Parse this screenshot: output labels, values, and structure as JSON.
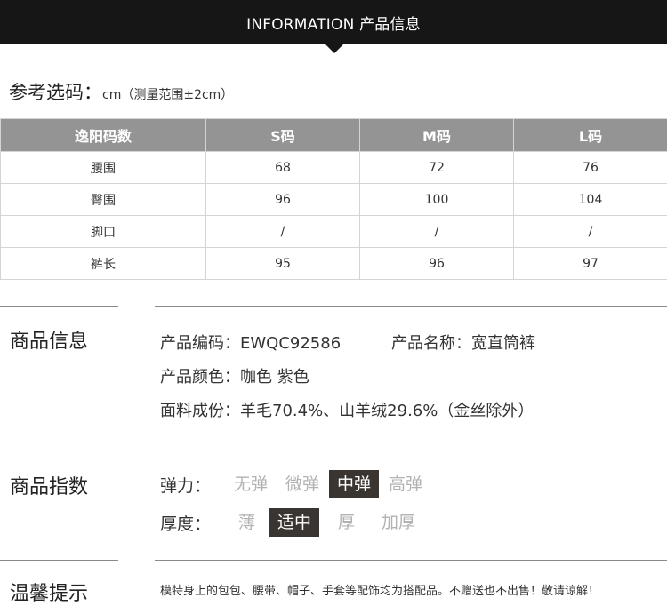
{
  "header": {
    "title": "INFORMATION 产品信息"
  },
  "size_reference": {
    "title": "参考选码：",
    "unit": "cm（测量范围±2cm）",
    "columns": [
      "逸阳码数",
      "S码",
      "M码",
      "L码"
    ],
    "rows": [
      [
        "腰围",
        "68",
        "72",
        "76"
      ],
      [
        "臀围",
        "96",
        "100",
        "104"
      ],
      [
        "脚口",
        "/",
        "/",
        "/"
      ],
      [
        "裤长",
        "95",
        "96",
        "97"
      ]
    ]
  },
  "product_info": {
    "title": "商品信息",
    "code": "产品编码：EWQC92586",
    "name": "产品名称：宽直筒裤",
    "color": "产品颜色：咖色  紫色",
    "material": "面料成份：羊毛70.4%、山羊绒29.6%（金丝除外）"
  },
  "product_index": {
    "title": "商品指数",
    "elasticity": {
      "label": "弹力：",
      "options": [
        "无弹",
        "微弹",
        "中弹",
        "高弹"
      ],
      "selected": "中弹"
    },
    "thickness": {
      "label": "厚度：",
      "options": [
        "薄",
        "适中",
        "厚",
        "加厚"
      ],
      "selected": "适中"
    }
  },
  "tips": {
    "title": "温馨提示",
    "text": "模特身上的包包、腰带、帽子、手套等配饰均为搭配品。不赠送也不出售！敬请谅解！"
  },
  "colors": {
    "header_bg": "#161616",
    "table_header_bg": "#949494",
    "selected_bg": "#3a3531",
    "unselected_text": "#b2b2b2"
  }
}
